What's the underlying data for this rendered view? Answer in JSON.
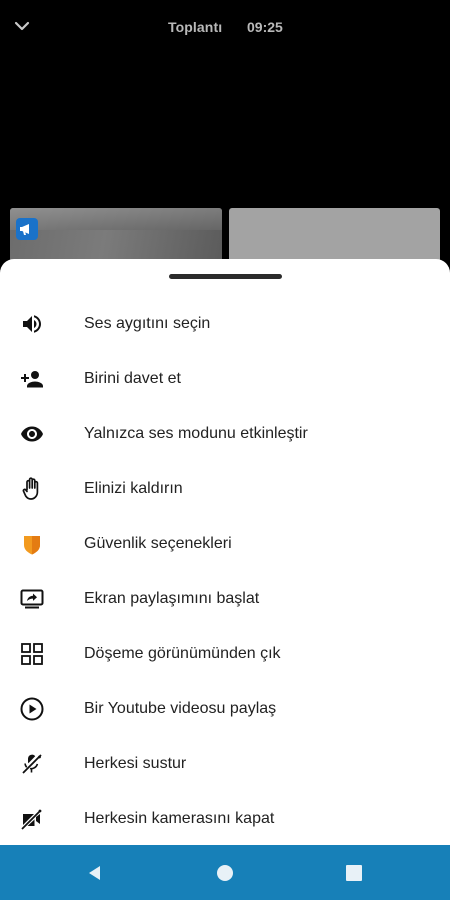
{
  "header": {
    "title": "Toplantı",
    "time": "09:25"
  },
  "menu": {
    "items": [
      {
        "label": "Ses aygıtını seçin",
        "icon": "volume-icon"
      },
      {
        "label": "Birini davet et",
        "icon": "person-add-icon"
      },
      {
        "label": "Yalnızca ses modunu etkinleştir",
        "icon": "eye-icon"
      },
      {
        "label": "Elinizi kaldırın",
        "icon": "raise-hand-icon"
      },
      {
        "label": "Güvenlik seçenekleri",
        "icon": "shield-icon"
      },
      {
        "label": "Ekran paylaşımını başlat",
        "icon": "screen-share-icon"
      },
      {
        "label": "Döşeme görünümünden çık",
        "icon": "tile-view-icon"
      },
      {
        "label": "Bir Youtube videosu paylaş",
        "icon": "play-circle-icon"
      },
      {
        "label": "Herkesi sustur",
        "icon": "mic-off-icon"
      },
      {
        "label": "Herkesin kamerasını kapat",
        "icon": "camera-off-icon"
      }
    ]
  },
  "colors": {
    "nav_bar": "#1780b8",
    "shield": "#f29a1f",
    "badge": "#1a72c9"
  }
}
